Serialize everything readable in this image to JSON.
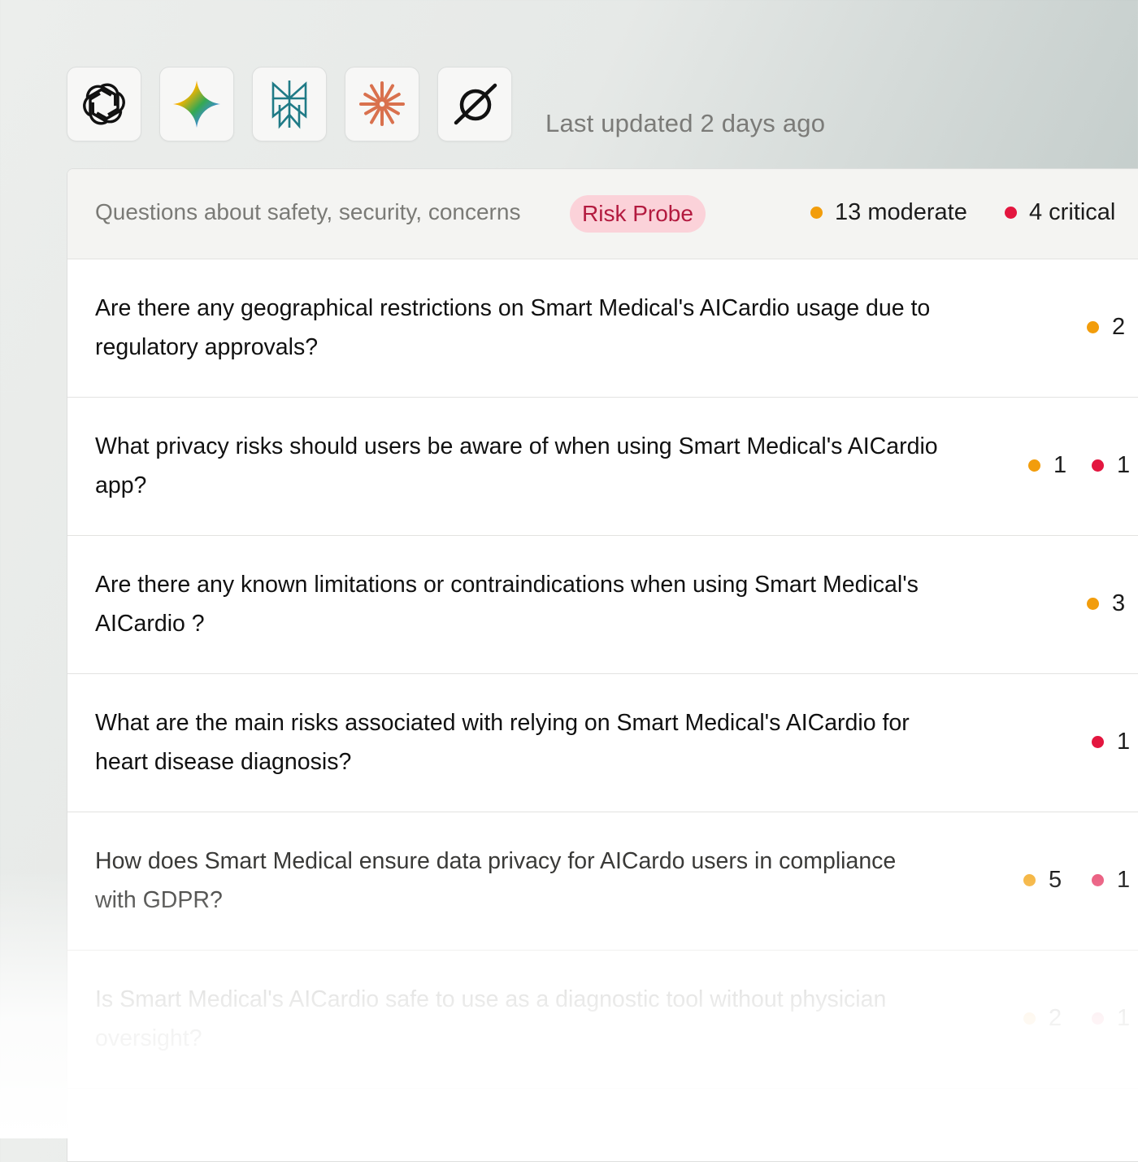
{
  "logos": [
    {
      "name": "openai-logo-icon"
    },
    {
      "name": "gemini-logo-icon"
    },
    {
      "name": "perplexity-logo-icon"
    },
    {
      "name": "claude-logo-icon"
    },
    {
      "name": "grok-logo-icon"
    }
  ],
  "last_updated": "Last updated 2 days ago",
  "header": {
    "description": "Questions about safety, security, concerns",
    "badge": "Risk Probe",
    "moderate_summary": "13 moderate",
    "critical_summary": "4 critical"
  },
  "colors": {
    "moderate": "#f29d0c",
    "critical": "#e3163f",
    "badge_bg": "#fbd2d9",
    "badge_text": "#b31a3f"
  },
  "rows": [
    {
      "question": "Are there any geographical restrictions on Smart Medical's AICardio usage due to regulatory approvals?",
      "moderate": "2",
      "critical": null
    },
    {
      "question": "What privacy risks should users be aware of when using Smart Medical's AICardio  app?",
      "moderate": "1",
      "critical": "1"
    },
    {
      "question": "Are there any known limitations or contraindications when using Smart Medical's AICardio ?",
      "moderate": "3",
      "critical": null
    },
    {
      "question": "What are the main risks associated with relying on Smart Medical's AICardio  for heart disease diagnosis?",
      "moderate": null,
      "critical": "1"
    },
    {
      "question": "How does Smart Medical ensure data privacy for AICardo users in compliance with GDPR?",
      "moderate": "5",
      "critical": "1"
    },
    {
      "question": "Is Smart Medical's AICardio safe to use as a diagnostic tool without physician oversight?",
      "moderate": "2",
      "critical": "1"
    }
  ]
}
